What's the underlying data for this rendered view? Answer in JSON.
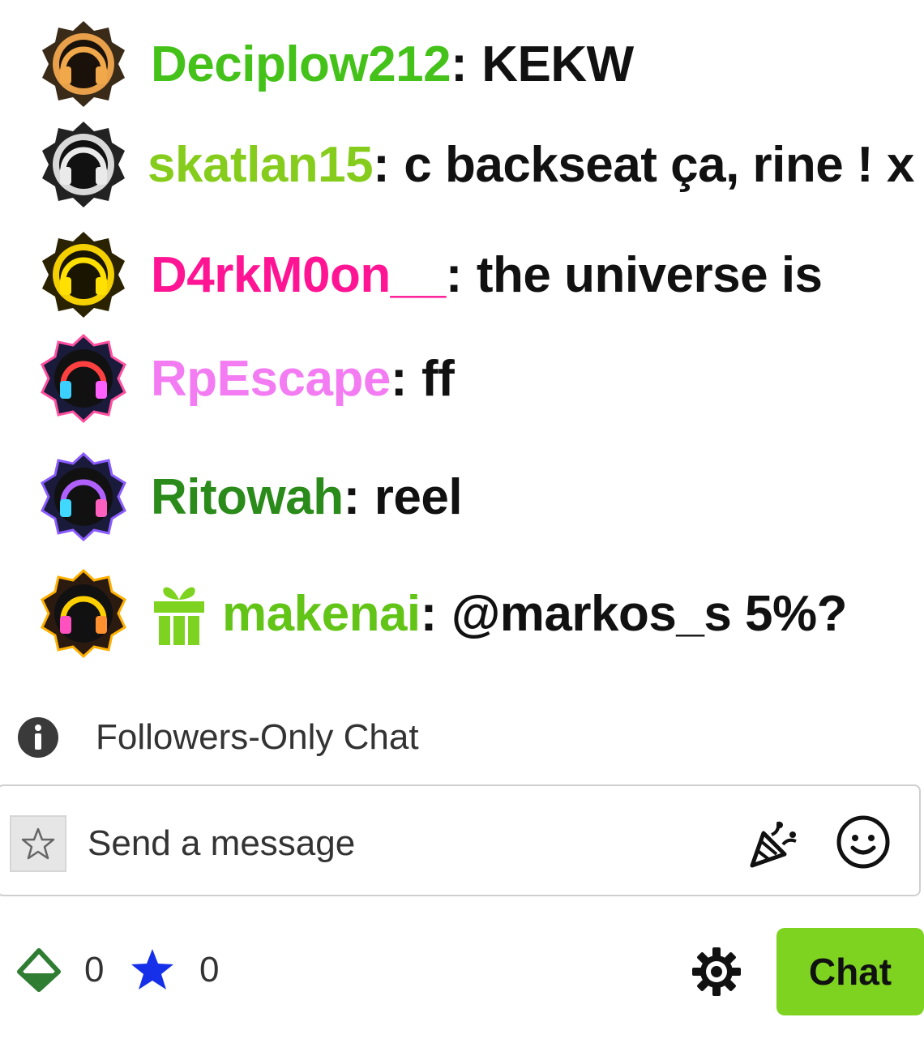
{
  "messages": [
    {
      "username": "Deciplow212",
      "text": "KEKW",
      "color": "#44c21a",
      "badge": "headphones-badge-bronze-icon",
      "gift": false
    },
    {
      "username": "skatlan15",
      "text": "c backseat ça, rine ! x",
      "color": "#86cc1c",
      "badge": "headphones-badge-silver-icon",
      "gift": false
    },
    {
      "username": "D4rkM0on__",
      "text": "the universe is",
      "color": "#ff1493",
      "badge": "headphones-badge-gold-icon",
      "gift": false
    },
    {
      "username": "RpEscape",
      "text": "ff",
      "color": "#f37cf3",
      "badge": "headphones-badge-neon-icon",
      "gift": false
    },
    {
      "username": "Ritowah",
      "text": "reel",
      "color": "#2a8a1a",
      "badge": "headphones-badge-neon-icon",
      "gift": false
    },
    {
      "username": "makenai",
      "text": "@markos_s 5%?",
      "color": "#62c416",
      "badge": "headphones-badge-rainbow-icon",
      "gift": true,
      "gift_icon": "gift-icon"
    }
  ],
  "followers_only": {
    "label": "Followers-Only Chat",
    "icon": "info-icon"
  },
  "input": {
    "placeholder": "Send a message"
  },
  "points": [
    {
      "icon": "channel-points-icon",
      "value": "0",
      "color": "#2e7d32"
    },
    {
      "icon": "star-icon",
      "value": "0",
      "color": "#1530e8"
    }
  ],
  "chat_button": {
    "label": "Chat",
    "color": "#7ed321"
  }
}
